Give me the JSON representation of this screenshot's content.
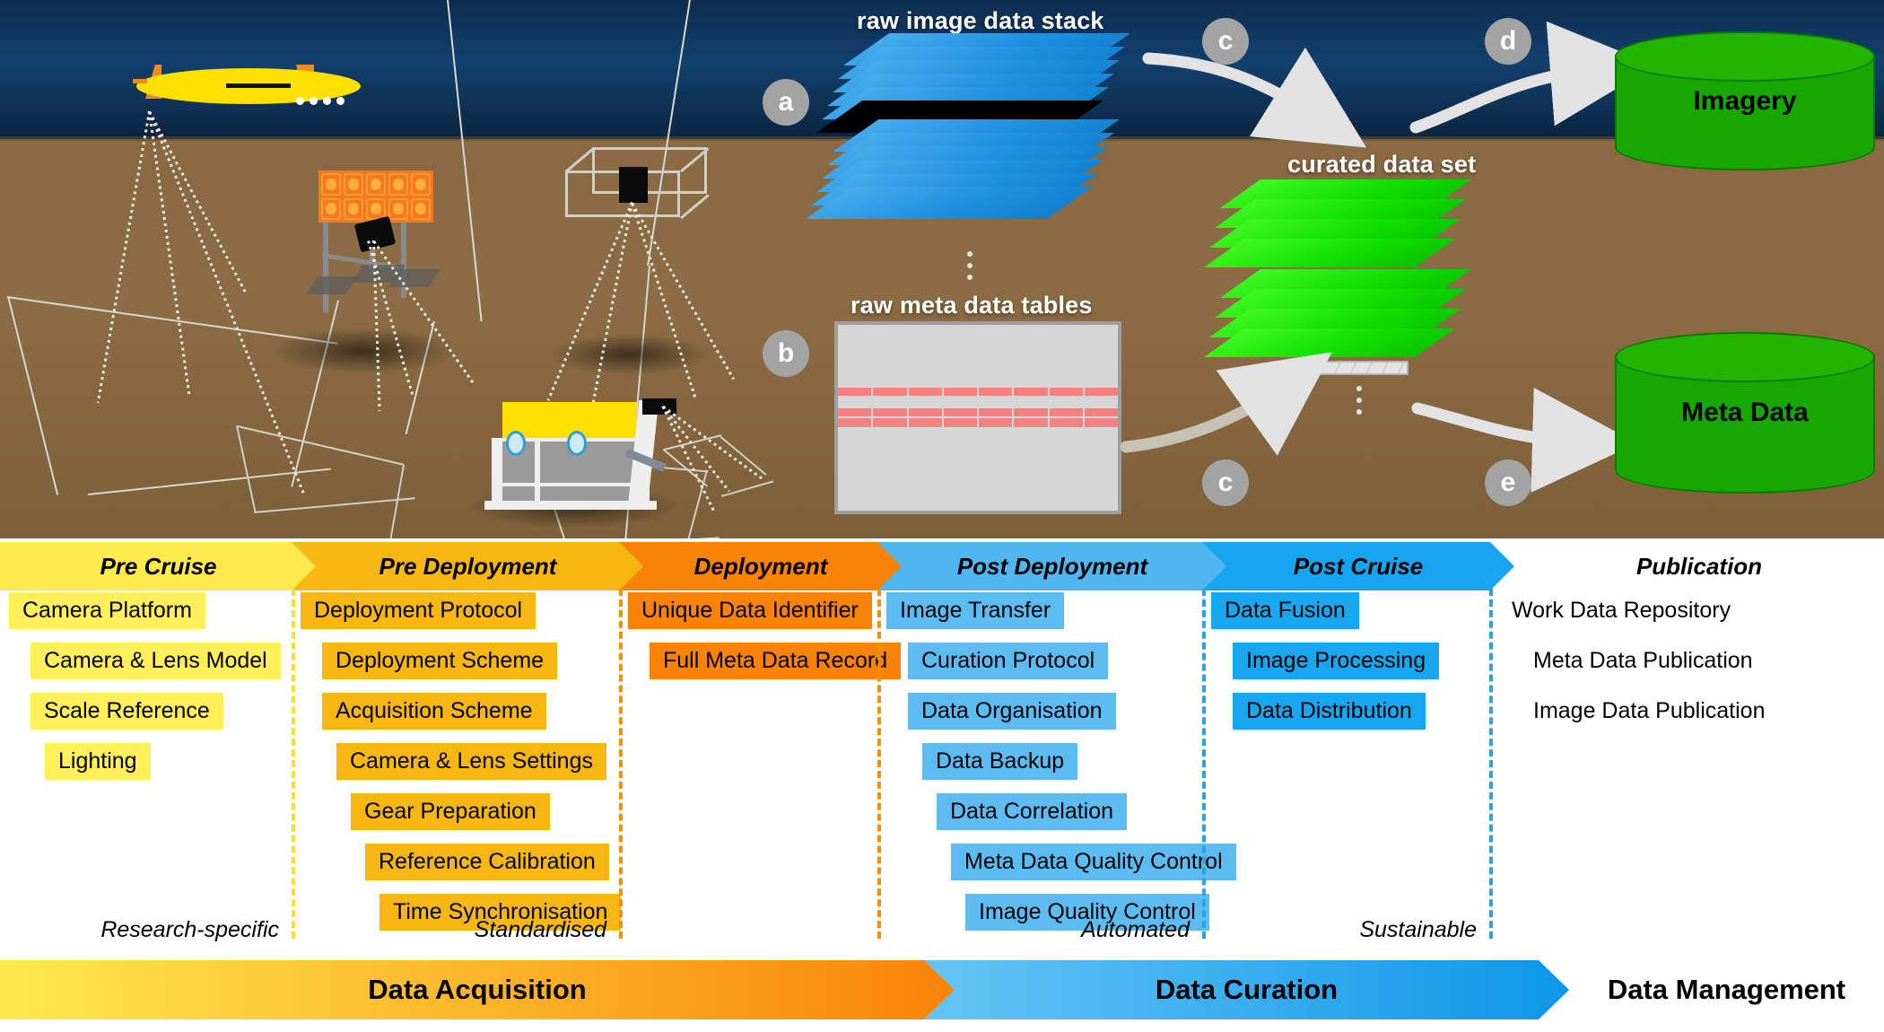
{
  "scene": {
    "labels": {
      "raw_image_stack": "raw image data stack",
      "raw_meta_tables": "raw meta data tables",
      "curated_data_set": "curated data set"
    },
    "markers": {
      "a": "a",
      "b": "b",
      "c_top": "c",
      "c_bottom": "c",
      "d": "d",
      "e": "e"
    },
    "databases": {
      "imagery": "Imagery",
      "metadata": "Meta Data"
    }
  },
  "flow": {
    "phases": [
      {
        "name": "pre-cruise",
        "header": "Pre Cruise",
        "color": "#ffe94d",
        "pill_color": "#ffef5a",
        "divider_color": "#f2e22a",
        "note": "Research-specific",
        "items": [
          "Camera Platform",
          "Camera & Lens Model",
          "Scale Reference",
          "Lighting"
        ]
      },
      {
        "name": "pre-deployment",
        "header": "Pre Deployment",
        "color": "#f7b713",
        "pill_color": "#f7b713",
        "divider_color": "#f19100",
        "note": "Standardised",
        "items": [
          "Deployment Protocol",
          "Deployment Scheme",
          "Acquisition Scheme",
          "Camera & Lens Settings",
          "Gear Preparation",
          "Reference Calibration",
          "Time Synchronisation"
        ]
      },
      {
        "name": "deployment",
        "header": "Deployment",
        "color": "#f98307",
        "pill_color": "#f98307",
        "divider_color": "#f19100",
        "note": "",
        "items": [
          "Unique Data Identifier",
          "Full Meta Data Record"
        ]
      },
      {
        "name": "post-deployment",
        "header": "Post Deployment",
        "color": "#4fb6f0",
        "pill_color": "#5cbcf2",
        "divider_color": "#2aa2e8",
        "note": "Automated",
        "items": [
          "Image Transfer",
          "Curation Protocol",
          "Data Organisation",
          "Data Backup",
          "Data Correlation",
          "Meta Data Quality Control",
          "Image Quality Control"
        ]
      },
      {
        "name": "post-cruise",
        "header": "Post Cruise",
        "color": "#16a5ee",
        "pill_color": "#18a6ef",
        "divider_color": "#2aa2e8",
        "note": "Sustainable",
        "items": [
          "Data Fusion",
          "Image Processing",
          "Data Distribution"
        ]
      },
      {
        "name": "publication",
        "header": "Publication",
        "color": "#5bc council",
        "pill_color": "#5cc council",
        "divider_color": "#49c23c",
        "note": "",
        "items": [
          "Work Data Repository",
          "Meta Data Publication",
          "Image Data Publication"
        ]
      }
    ],
    "bands": [
      {
        "label": "Data Acquisition",
        "from": "#ffe94d",
        "to": "#f98307"
      },
      {
        "label": "Data Curation",
        "from": "#66c4f5",
        "to": "#0d96e8"
      },
      {
        "label": "Data Management",
        "from": "#63c council",
        "to": "#55bd39"
      }
    ]
  }
}
